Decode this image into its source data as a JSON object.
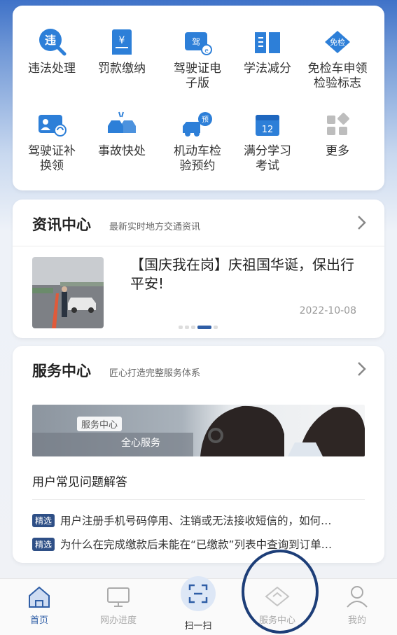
{
  "grid": {
    "items": [
      {
        "label": "违法处理",
        "icon": "violation-search-icon"
      },
      {
        "label": "罚款缴纳",
        "icon": "fine-bill-icon"
      },
      {
        "label": "驾驶证电\n子版",
        "icon": "e-license-icon"
      },
      {
        "label": "学法减分",
        "icon": "book-icon"
      },
      {
        "label": "免检车申领\n检验标志",
        "icon": "inspection-exempt-icon"
      },
      {
        "label": "驾驶证补\n换领",
        "icon": "license-renew-icon"
      },
      {
        "label": "事故快处",
        "icon": "accident-icon"
      },
      {
        "label": "机动车检\n验预约",
        "icon": "truck-booking-icon"
      },
      {
        "label": "满分学习\n考试",
        "icon": "calendar-12-icon"
      },
      {
        "label": "更多",
        "icon": "more-grid-icon"
      }
    ]
  },
  "news": {
    "title": "资讯中心",
    "subtitle": "最新实时地方交通资讯",
    "article_title": "【国庆我在岗】庆祖国华诞，保出行平安!",
    "date": "2022-10-08"
  },
  "service": {
    "title": "服务中心",
    "subtitle": "匠心打造完整服务体系",
    "banner_tag": "服务中心",
    "banner_text": "全心服务",
    "faq_title": "用户常见问题解答",
    "faq": [
      {
        "badge": "精选",
        "text": "用户注册手机号码停用、注销或无法接收短信的，如何…"
      },
      {
        "badge": "精选",
        "text": "为什么在完成缴款后未能在“已缴款”列表中查询到订单…"
      }
    ]
  },
  "tabbar": {
    "tabs": [
      {
        "label": "首页",
        "icon": "home-icon",
        "active": true
      },
      {
        "label": "网办进度",
        "icon": "monitor-icon"
      },
      {
        "label": "扫一扫",
        "icon": "scan-icon"
      },
      {
        "label": "服务中心",
        "icon": "service-diamond-icon"
      },
      {
        "label": "我的",
        "icon": "user-icon"
      }
    ]
  },
  "colors": {
    "accent": "#2f5ea6",
    "icon_blue": "#2d7fd8",
    "annotation": "#1d3e78"
  }
}
